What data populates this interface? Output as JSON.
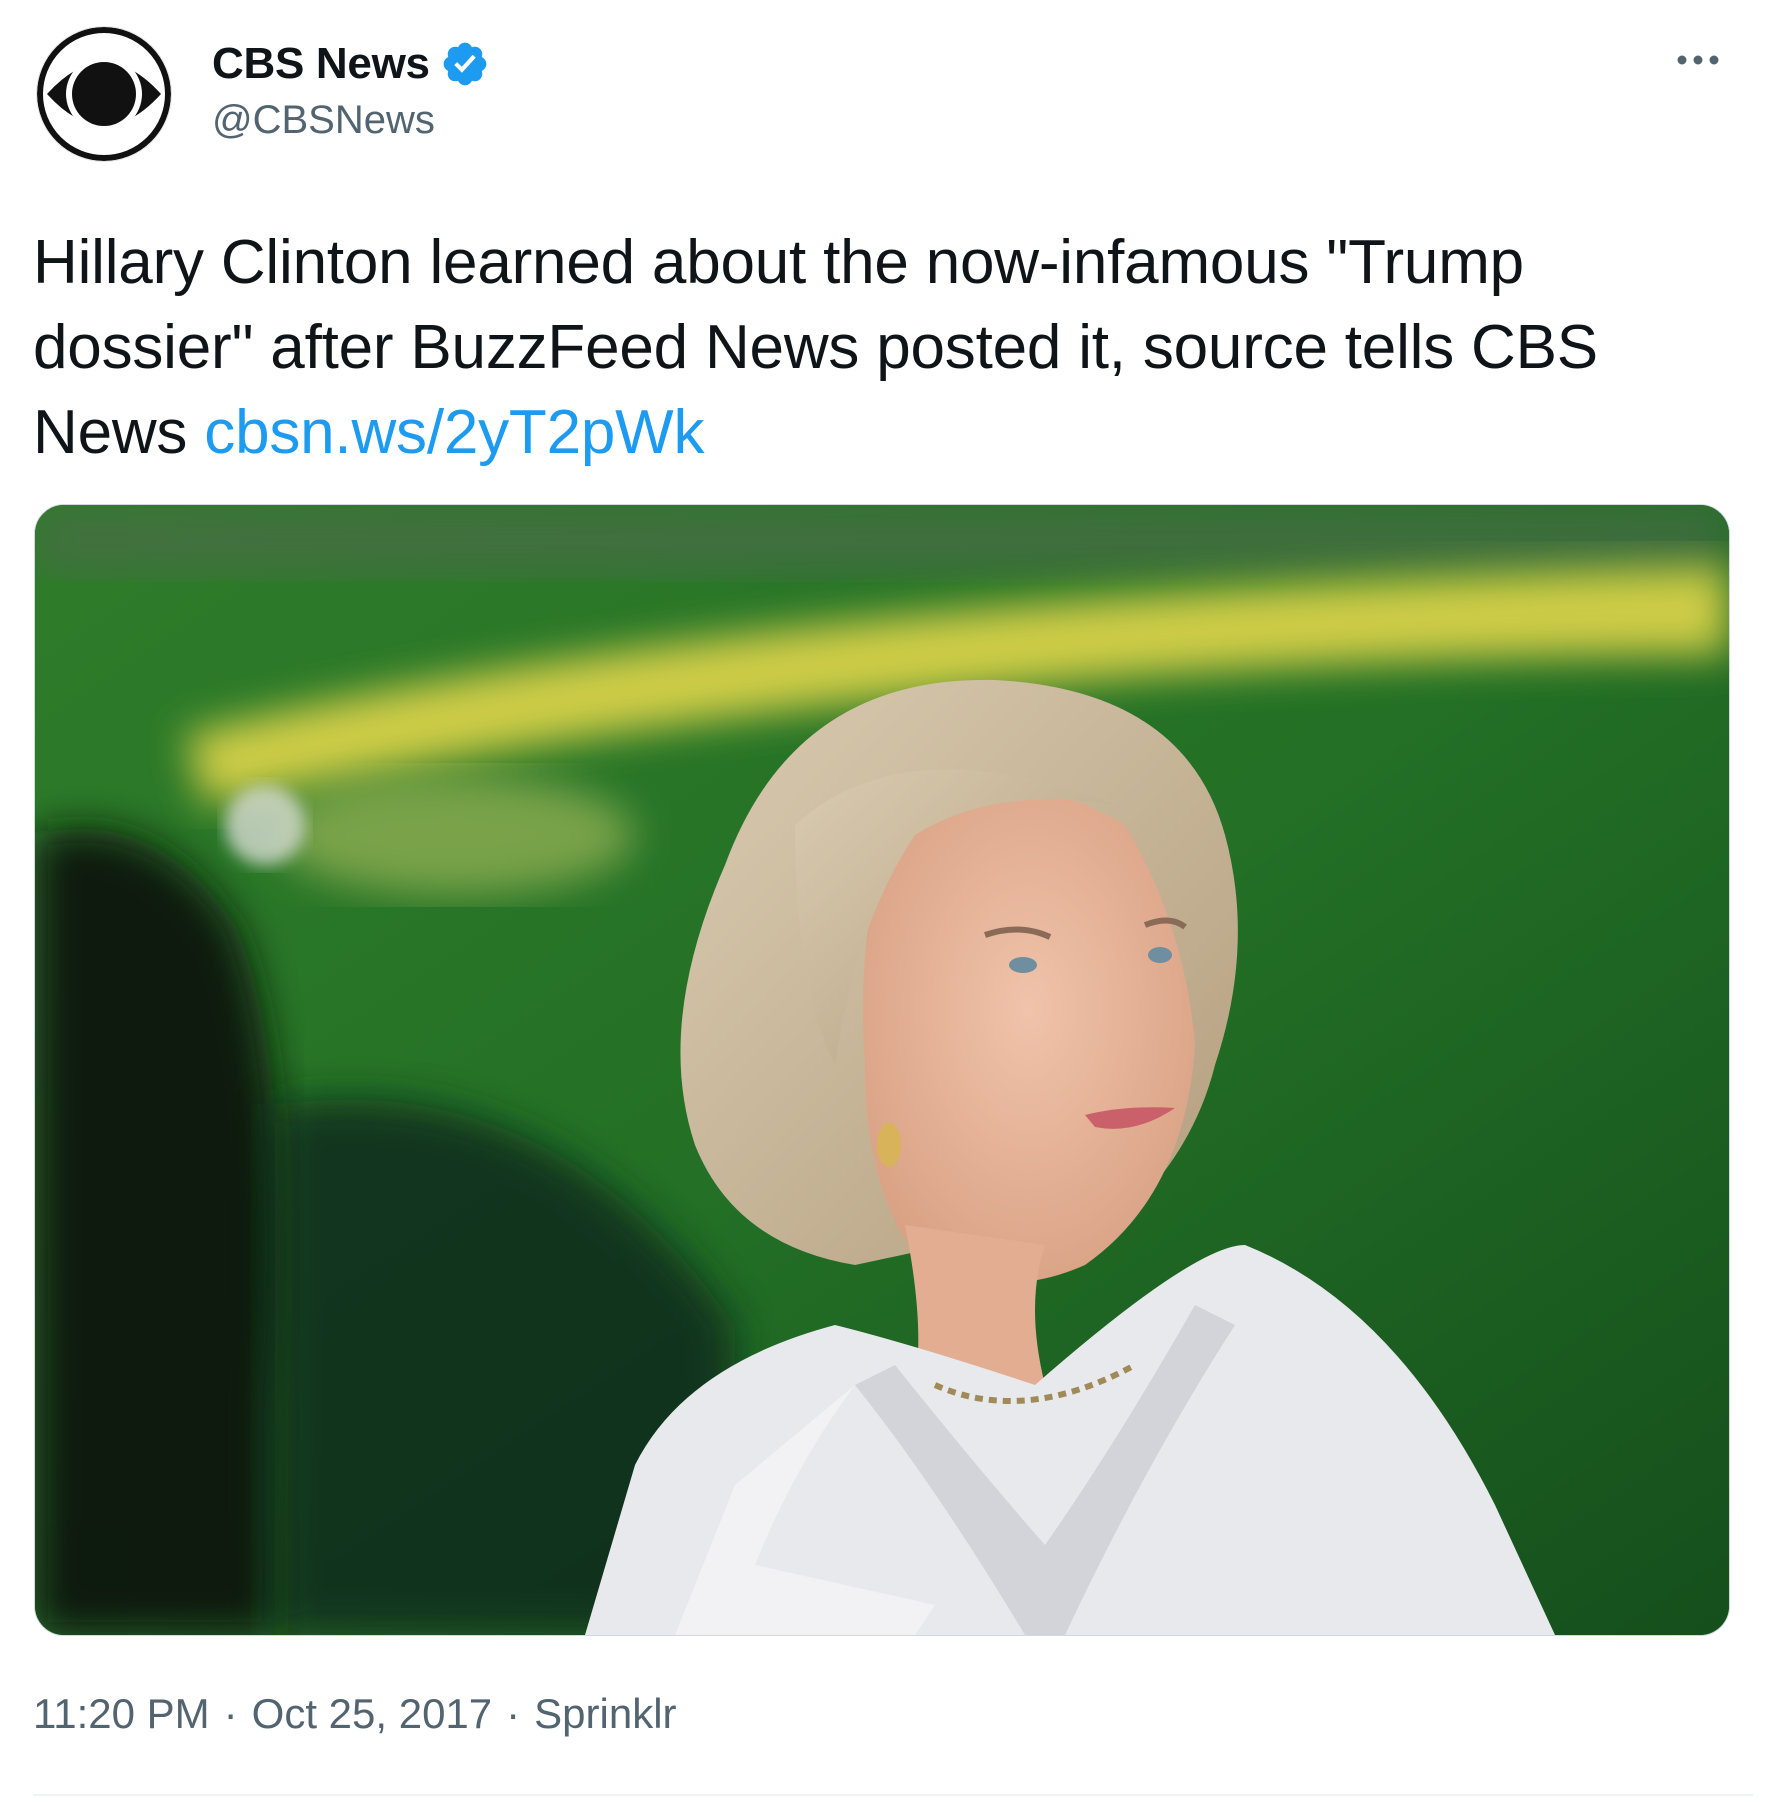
{
  "author": {
    "display_name": "CBS News",
    "handle": "@CBSNews",
    "verified": true,
    "avatar_icon": "cbs-eye-logo"
  },
  "tweet": {
    "text_before_link": "Hillary Clinton learned about the now-infamous \"Trump dossier\" after BuzzFeed News posted it, source tells CBS News ",
    "link_text": "cbsn.ws/2yT2pWk"
  },
  "meta": {
    "time": "11:20 PM",
    "separator": "·",
    "date": "Oct 25, 2017",
    "source": "Sprinklr"
  },
  "colors": {
    "link": "#1d9bf0",
    "verified_badge": "#1d9bf0",
    "secondary_text": "#536471",
    "primary_text": "#0f1419"
  }
}
